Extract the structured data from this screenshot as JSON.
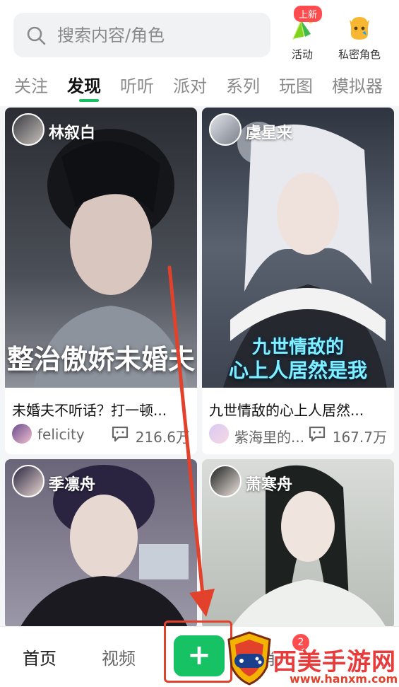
{
  "search": {
    "placeholder": "搜索内容/角色"
  },
  "quick_actions": [
    {
      "label": "活动",
      "badge": "上新",
      "icon": "activity-icon"
    },
    {
      "label": "私密角色",
      "icon": "private-character-icon"
    }
  ],
  "tabs": [
    "关注",
    "发现",
    "听听",
    "派对",
    "系列",
    "玩图",
    "模拟器"
  ],
  "active_tab": "发现",
  "cards": [
    {
      "character": "林叙白",
      "overlay": "整治傲娇未婚夫",
      "title": "未婚夫不听话？打一顿...",
      "user": "felicity",
      "count": "216.6万"
    },
    {
      "character": "虞星来",
      "overlay_line1": "九世情敌的",
      "overlay_line2": "心上人居然是我",
      "title": "九世情敌的心上人居然...",
      "user": "紫海里的...",
      "count": "167.7万"
    },
    {
      "character": "季凛舟"
    },
    {
      "character": "萧寒舟"
    }
  ],
  "bottom_nav": {
    "home": "首页",
    "video": "视频",
    "create": "+",
    "message_partial": "消",
    "notif_count": "2"
  },
  "watermark": {
    "text": "西美手游网",
    "url": "www.hanxm.com"
  },
  "colors": {
    "accent": "#17c264",
    "badge": "#ff4d4f",
    "annotation": "#e2412b"
  }
}
